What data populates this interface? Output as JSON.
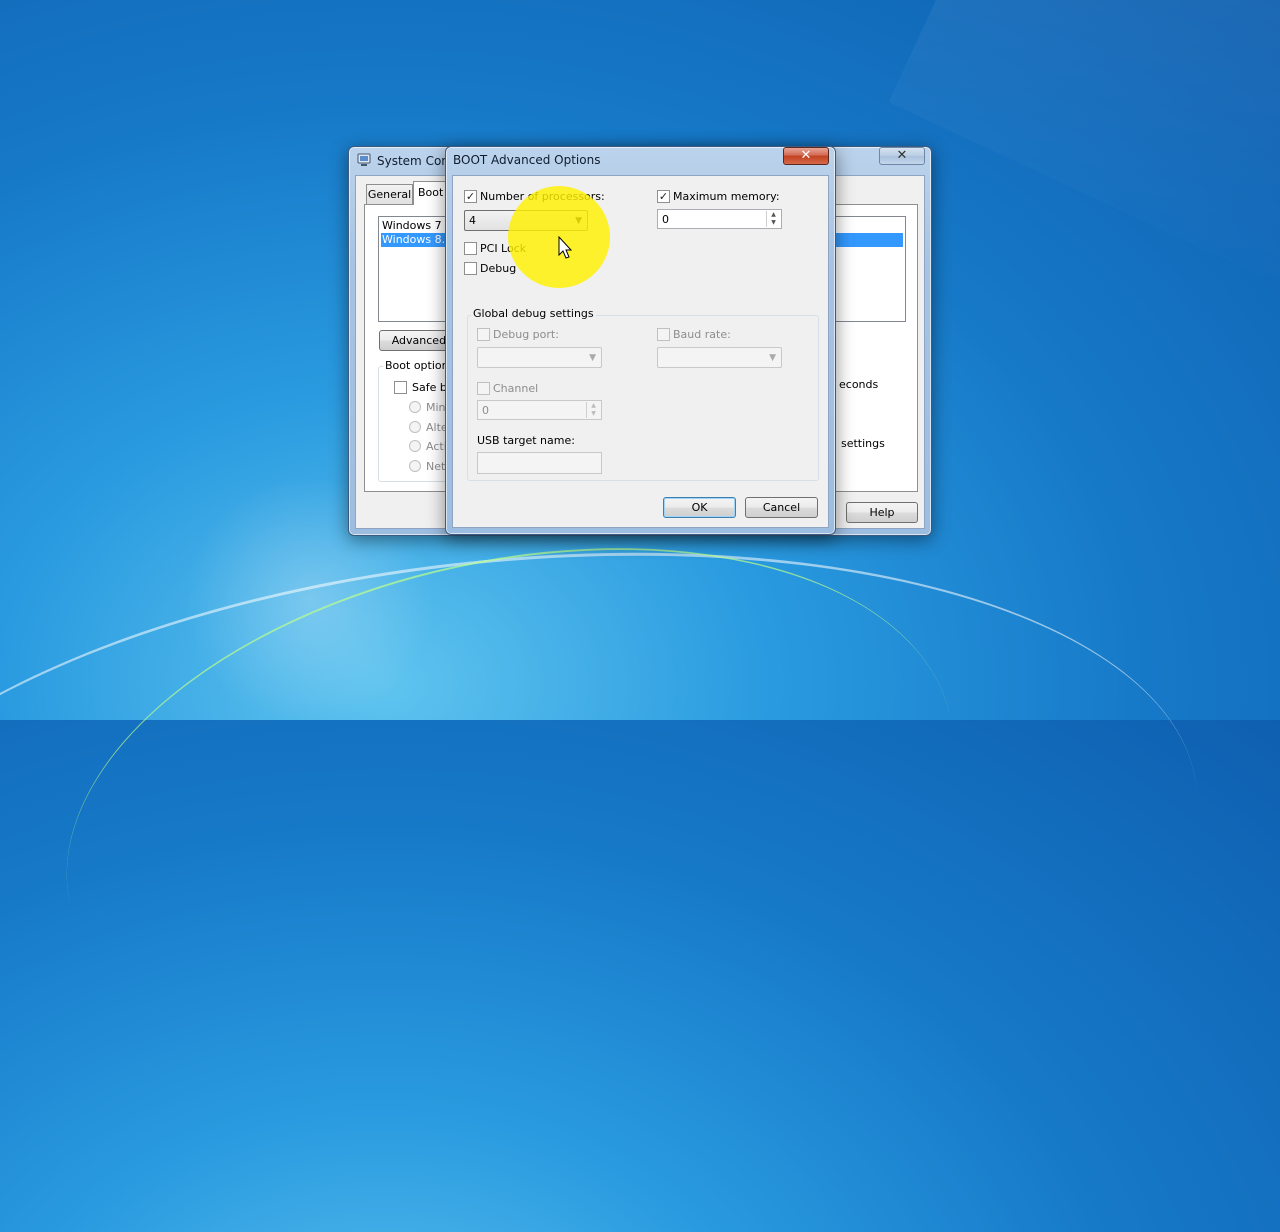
{
  "msconfig": {
    "title": "System Conf",
    "tabs": [
      "General",
      "Boot"
    ],
    "os_list": [
      "Windows 7 Ul",
      "Windows 8.1"
    ],
    "advanced_button": "Advanced o",
    "boot_options_label": "Boot options",
    "safe_boot_label": "Safe bo",
    "radios": [
      "Mini",
      "Alte",
      "Acti",
      "Netw"
    ],
    "seconds_label": "econds",
    "settings_label": "settings",
    "help_button": "Help",
    "close_glyph": "✕"
  },
  "dialog": {
    "title": "BOOT Advanced Options",
    "close_glyph": "✕",
    "num_processors": {
      "label": "Number of processors:",
      "checked": true,
      "value": "4"
    },
    "max_memory": {
      "label": "Maximum memory:",
      "checked": true,
      "value": "0"
    },
    "pci_lock": {
      "label": "PCI Lock",
      "checked": false
    },
    "debug": {
      "label": "Debug",
      "checked": false
    },
    "global_debug": {
      "title": "Global debug settings",
      "debug_port_label": "Debug port:",
      "baud_rate_label": "Baud rate:",
      "channel_label": "Channel",
      "channel_value": "0",
      "usb_target_label": "USB target name:"
    },
    "ok_button": "OK",
    "cancel_button": "Cancel"
  },
  "glyphs": {
    "check": "✓",
    "dropdown": "▼",
    "spin_up": "▲",
    "spin_down": "▼"
  }
}
